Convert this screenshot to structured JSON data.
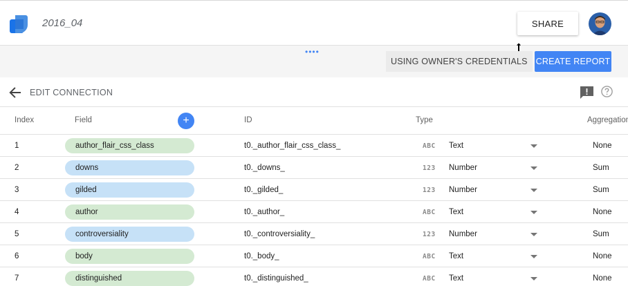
{
  "header": {
    "title": "2016_04",
    "share_label": "SHARE"
  },
  "toolbar": {
    "credentials_label": "USING OWNER'S CREDENTIALS",
    "create_report_label": "CREATE REPORT",
    "drag_handle": "••••"
  },
  "edit": {
    "label": "EDIT CONNECTION"
  },
  "table": {
    "columns": {
      "index": "Index",
      "field": "Field",
      "id": "ID",
      "type": "Type",
      "aggregation": "Aggregation"
    },
    "add_label": "+",
    "rows": [
      {
        "index": "1",
        "field": "author_flair_css_class",
        "kind": "dimension",
        "id": "t0._author_flair_css_class_",
        "type_icon": "ABC",
        "type": "Text",
        "agg": "None"
      },
      {
        "index": "2",
        "field": "downs",
        "kind": "metric",
        "id": "t0._downs_",
        "type_icon": "123",
        "type": "Number",
        "agg": "Sum"
      },
      {
        "index": "3",
        "field": "gilded",
        "kind": "metric",
        "id": "t0._gilded_",
        "type_icon": "123",
        "type": "Number",
        "agg": "Sum"
      },
      {
        "index": "4",
        "field": "author",
        "kind": "dimension",
        "id": "t0._author_",
        "type_icon": "ABC",
        "type": "Text",
        "agg": "None"
      },
      {
        "index": "5",
        "field": "controversiality",
        "kind": "metric",
        "id": "t0._controversiality_",
        "type_icon": "123",
        "type": "Number",
        "agg": "Sum"
      },
      {
        "index": "6",
        "field": "body",
        "kind": "dimension",
        "id": "t0._body_",
        "type_icon": "ABC",
        "type": "Text",
        "agg": "None"
      },
      {
        "index": "7",
        "field": "distinguished",
        "kind": "dimension",
        "id": "t0._distinguished_",
        "type_icon": "ABC",
        "type": "Text",
        "agg": "None"
      }
    ]
  },
  "colors": {
    "accent": "#4285f4",
    "dimension_chip": "#d4ead2",
    "metric_chip": "#c6e1f7"
  }
}
